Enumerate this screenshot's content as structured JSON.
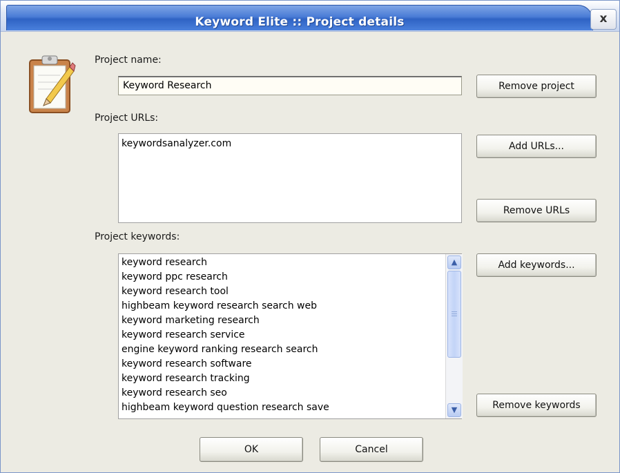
{
  "window": {
    "title": "Keyword Elite :: Project details",
    "close_glyph": "x"
  },
  "icons": {
    "project_icon": "clipboard-pencil-icon"
  },
  "fields": {
    "project_name_label": "Project name:",
    "project_name_value": "Keyword Research",
    "project_urls_label": "Project URLs:",
    "project_keywords_label": "Project keywords:"
  },
  "urls": [
    "keywordsanalyzer.com"
  ],
  "keywords": [
    "keyword research",
    "keyword ppc research",
    "keyword research tool",
    "highbeam keyword research search web",
    "keyword marketing research",
    "keyword research service",
    "engine keyword ranking research search",
    "keyword research software",
    "keyword research tracking",
    "keyword research seo",
    "highbeam keyword question research save"
  ],
  "buttons": {
    "remove_project": "Remove project",
    "add_urls": "Add URLs...",
    "remove_urls": "Remove URLs",
    "add_keywords": "Add keywords...",
    "remove_keywords": "Remove keywords",
    "ok": "OK",
    "cancel": "Cancel"
  }
}
